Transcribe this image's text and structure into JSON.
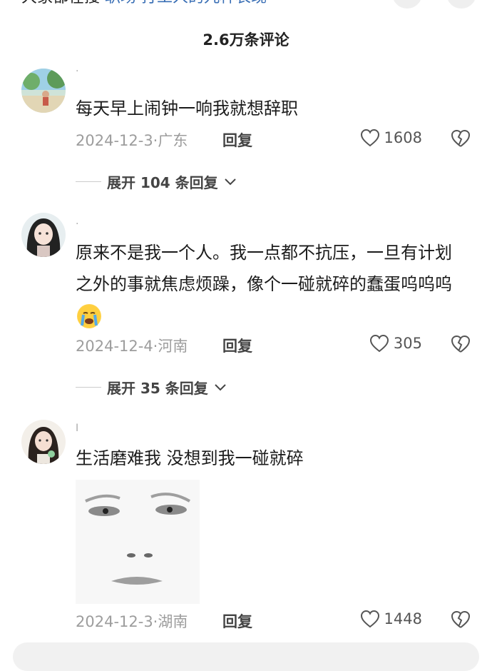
{
  "topbar": {
    "text_dark": "大家都在搜",
    "text_link": "·职场·打工人的九种表现"
  },
  "header": {
    "title": "2.6万条评论"
  },
  "comments": [
    {
      "username": "·",
      "text": "每天早上闹钟一响我就想辞职",
      "date": "2024-12-3·",
      "location": "广东",
      "reply_label": "回复",
      "likes": "1608",
      "expand_label": "展开 104 条回复"
    },
    {
      "username": "·",
      "text": "原来不是我一个人。我一点都不抗压，一旦有计划之外的事就焦虑烦躁，像个一碰就碎的蠢蛋呜呜呜",
      "date": "2024-12-4·",
      "location": "河南",
      "reply_label": "回复",
      "likes": "305",
      "expand_label": "展开 35 条回复"
    },
    {
      "username": "Ⅰ",
      "text": "生活磨难我 没想到我一碰就碎",
      "date": "2024-12-3·",
      "location": "湖南",
      "reply_label": "回复",
      "likes": "1448"
    }
  ],
  "colors": {
    "link": "#3a6fb5",
    "meta": "#9d9d9d"
  }
}
